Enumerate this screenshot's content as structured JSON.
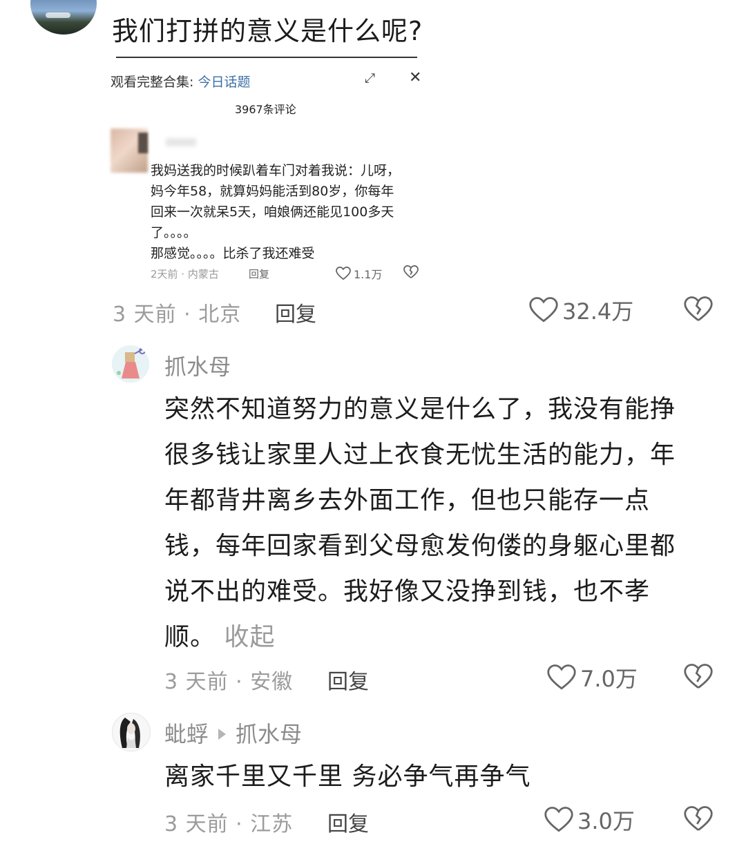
{
  "header": {
    "title": "我们打拼的意义是什么呢?"
  },
  "embedded_screenshot": {
    "collection_prefix": "观看完整合集: ",
    "collection_link": "今日话题",
    "expand_icon": "⤢",
    "close_icon": "✕",
    "comment_count": "3967条评论",
    "comment_lines": [
      "我妈送我的时候趴着车门对着我说：儿呀，",
      "妈今年58，就算妈妈能活到80岁，你每年",
      "回来一次就呆5天，咱娘俩还能见100多天",
      "了。。。。",
      "那感觉。。。。比杀了我还难受"
    ],
    "meta": "2天前 · 内蒙古",
    "reply_label": "回复",
    "likes": "1.1万"
  },
  "post_meta": {
    "time_location": "3 天前 · 北京",
    "reply_label": "回复",
    "likes": "32.4万"
  },
  "comments": [
    {
      "username": "抓水母",
      "lines": [
        "突然不知道努力的意义是什么了，我没有能挣",
        "很多钱让家里人过上衣食无忧生活的能力，年",
        "年都背井离乡去外面工作，但也只能存一点",
        "钱，每年回家看到父母愈发佝偻的身躯心里都",
        "说不出的难受。我好像又没挣到钱，也不孝",
        "顺。"
      ],
      "collapse_label": "收起",
      "time_location": "3 天前 · 安徽",
      "reply_label": "回复",
      "likes": "7.0万"
    },
    {
      "username": "蚍蜉",
      "reply_to": "抓水母",
      "text": "离家千里又千里 务必争气再争气",
      "time_location": "3 天前 · 江苏",
      "reply_label": "回复",
      "likes": "3.0万"
    }
  ],
  "colors": {
    "text_primary": "#1c1c1c",
    "text_muted": "#9b9b9b",
    "link": "#3a6ea5"
  },
  "icons": [
    "heart-icon",
    "broken-heart-icon",
    "expand-icon",
    "close-icon",
    "reply-arrow-icon"
  ]
}
